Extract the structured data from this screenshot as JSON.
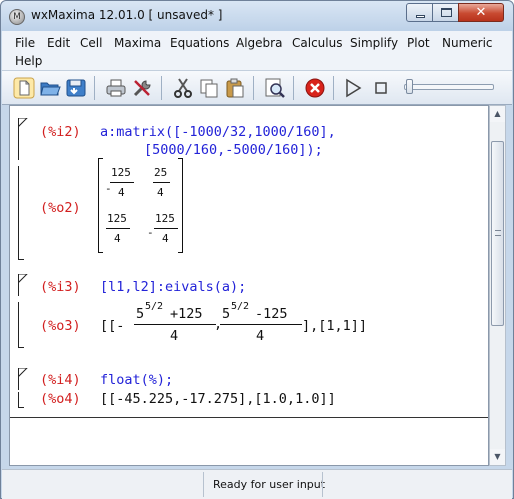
{
  "window": {
    "title": "wxMaxima 12.01.0 [ unsaved* ]",
    "app_icon_glyph": "M",
    "close_glyph": "✕"
  },
  "menu": [
    "File",
    "Edit",
    "Cell",
    "Maxima",
    "Equations",
    "Algebra",
    "Calculus",
    "Simplify",
    "Plot",
    "Numeric",
    "Help"
  ],
  "toolbar": {
    "icons": [
      "new-document-icon",
      "open-folder-icon",
      "save-icon",
      "print-icon",
      "config-icon",
      "cut-icon",
      "copy-icon",
      "paste-icon",
      "find-icon",
      "interrupt-icon",
      "play-icon",
      "stop-icon",
      "animation-slider"
    ]
  },
  "worksheet": {
    "cell1": {
      "input_label": "(%i2)",
      "input_line1": "a:matrix([-1000/32,1000/160],",
      "input_line2": "[5000/160,-5000/160]);",
      "output_label": "(%o2)",
      "matrix": [
        [
          {
            "sign": "-",
            "num": "125",
            "den": "4"
          },
          {
            "sign": "",
            "num": "25",
            "den": "4"
          }
        ],
        [
          {
            "sign": "",
            "num": "125",
            "den": "4"
          },
          {
            "sign": "-",
            "num": "125",
            "den": "4"
          }
        ]
      ]
    },
    "cell2": {
      "input_label": "(%i3)",
      "input": "[l1,l2]:eivals(a);",
      "output_label": "(%o3)",
      "out_open": "[[-",
      "frac1_num_base": "5",
      "frac1_num_exp": "5/2",
      "frac1_num_rest": "+125",
      "frac1_den": "4",
      "comma1": ",",
      "frac2_num_base": "5",
      "frac2_num_exp": "5/2",
      "frac2_num_rest": "-125",
      "frac2_den": "4",
      "out_close": "],[1,1]]"
    },
    "cell3": {
      "input_label": "(%i4)",
      "input": "float(%);",
      "output_label": "(%o4)",
      "output": "[[-45.225,-17.275],[1.0,1.0]]"
    }
  },
  "status": {
    "text": "Ready for user input"
  }
}
